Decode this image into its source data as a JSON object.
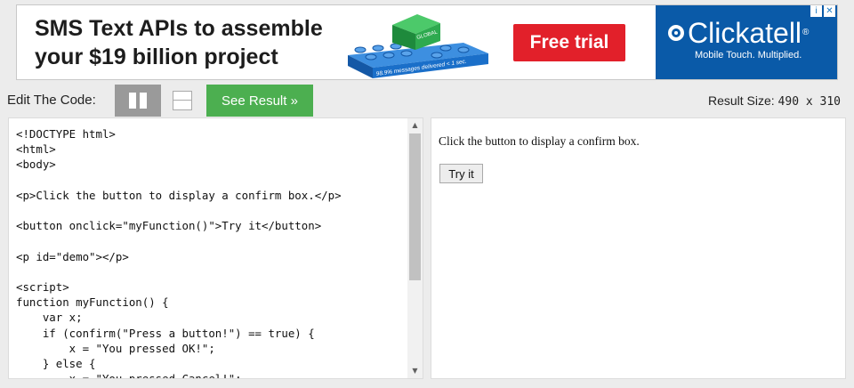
{
  "ad": {
    "headline_line1": "SMS Text APIs to assemble",
    "headline_line2": "your $19 billion project",
    "lego_label": "GLOBAL",
    "lego_subtext": "98.9% messages delivered < 1 sec.",
    "cta_label": "Free trial",
    "brand_name": "Clickatell",
    "brand_registered": "®",
    "brand_tagline": "Mobile Touch. Multiplied.",
    "adchoices_info": "i",
    "adchoices_close": "✕",
    "colors": {
      "cta": "#e2202a",
      "brand_bg": "#0a5aa8",
      "lego_blue": "#1a6fc9",
      "lego_green": "#2eaa4f"
    }
  },
  "toolbar": {
    "edit_label": "Edit The Code:",
    "see_result_label": "See Result »",
    "result_size_label": "Result Size:",
    "result_size_value": "490 x 310",
    "colors": {
      "see_result": "#4caf50",
      "layout_active": "#9a9a9a"
    }
  },
  "editor": {
    "code": "<!DOCTYPE html>\n<html>\n<body>\n\n<p>Click the button to display a confirm box.</p>\n\n<button onclick=\"myFunction()\">Try it</button>\n\n<p id=\"demo\"></p>\n\n<script>\nfunction myFunction() {\n    var x;\n    if (confirm(\"Press a button!\") == true) {\n        x = \"You pressed OK!\";\n    } else {\n        x = \"You pressed Cancel!\";"
  },
  "result": {
    "text": "Click the button to display a confirm box.",
    "button_label": "Try it"
  }
}
